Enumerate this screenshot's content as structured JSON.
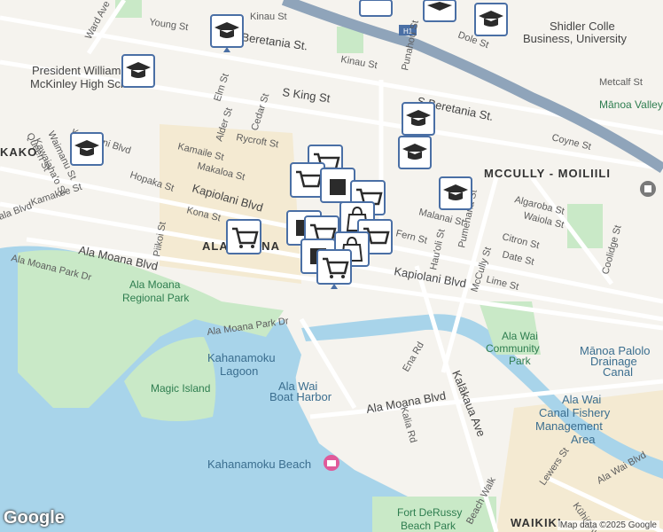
{
  "map": {
    "attribution": "Map data ©2025 Google",
    "logo": "Google",
    "colors": {
      "water": "#a8d4ea",
      "park": "#c9e9c7",
      "road": "#ffffff",
      "highway": "#8fa4ba",
      "land": "#f5f3ee",
      "marker_bg": "#ffffff",
      "marker_border": "#4a6fa5",
      "marker_icon": "#2b2b2b"
    }
  },
  "labels": {
    "ward_ave": "Ward Ave",
    "young_st": "Young St",
    "kinau_st": "Kinau St",
    "beretania_st": "Beretania St.",
    "kinau_st2": "Kinau St",
    "punahou_st": "Punahou St",
    "dole_st": "Dole St",
    "h1": "H1",
    "shidler": "Shidler College of Business, University",
    "metcalf_st": "Metcalf St",
    "mckinley_hs": "President William McKinley High School",
    "s_king_st": "S King St",
    "s_beretania_st": "S Beretania St.",
    "manoa_valley": "Mānoa Valley",
    "coyne_st": "Coyne St",
    "kapiolani_blvd_w": "Kapiolani Blvd",
    "elm_st": "Elm St",
    "cedar_st": "Cedar St",
    "alder_st": "Alder St",
    "rycroft_st": "Rycroft St",
    "kamaile_st": "Kamaile St",
    "makaloa_st": "Makaloa St",
    "waimanu_st": "Waimanu St",
    "kawaiahao_st": "Kawaiaha'o St",
    "queen_st": "Queen St",
    "kako": "KAKO",
    "hopaka_st": "Hopaka St",
    "kapiolani_blvd": "Kapiolani Blvd",
    "kamakee_st": "Kamakee St",
    "kona_st": "Kona St",
    "piikoi_st": "Piikoi St",
    "ala_moana": "ALA MOANA",
    "mccully_moiliili": "MCCULLY - MOILIILI",
    "malanai_st": "Malanai St",
    "algaroba_st": "Algaroba St",
    "waiola_st": "Waiola St",
    "citron_st": "Citron St",
    "date_st": "Date St",
    "fern_st": "Fern St",
    "hauoli_st": "Hau'oli St",
    "pumehana_st": "Pumehana St",
    "coolidge_st": "Coolidge St",
    "lime_st": "Lime St",
    "mccully_st": "McCully St",
    "kapiolani_blvd_e": "Kapiolani Blvd",
    "ala_moana_blvd": "Ala Moana Blvd",
    "ala_moana_park_dr": "Ala Moana Park Dr",
    "ala_moana_regional_park": "Ala Moana Regional Park",
    "ala_moana_park_dr2": "Ala Moana Park Dr",
    "kahanamoku_lagoon": "Kahanamoku Lagoon",
    "ala_wai_boat_harbor": "Ala Wai Boat Harbor",
    "magic_island": "Magic Island",
    "ena_rd": "Ena Rd",
    "ala_moana_blvd2": "Ala Moana Blvd",
    "kalia_rd": "Kalia Rd",
    "kalakaua_ave": "Kalākaua Ave",
    "ala_wai_community_park": "Ala Wai Community Park",
    "manoa_palolo_canal": "Mānoa Palolo Drainage Canal",
    "ala_wai_canal": "Ala Wai Canal Fishery Management Area",
    "lewers_st": "Lewers St",
    "kuhio_ave": "Kūhiō Ave",
    "ala_wai_blvd": "Ala Wai Blvd",
    "kahanamoku_beach": "Kahanamoku Beach",
    "fort_derussy": "Fort DeRussy Beach Park",
    "beach_walk": "Beach Walk",
    "waikiki": "WAIKIKI",
    "ala_blvd": "ala Blvd"
  }
}
